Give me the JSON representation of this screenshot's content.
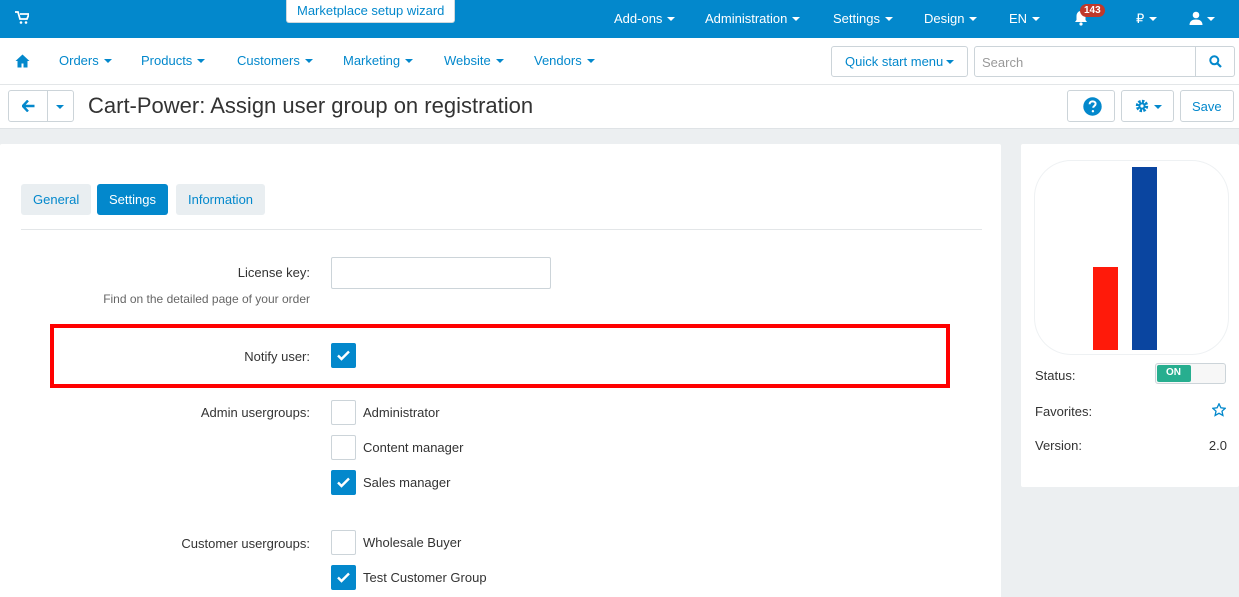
{
  "topbar": {
    "wizard_label": "Marketplace setup wizard",
    "menu": [
      "Add-ons",
      "Administration",
      "Settings",
      "Design",
      "EN",
      "₽"
    ],
    "notifications_count": "143",
    "icons": [
      "cart-icon",
      "bell-icon",
      "user-icon"
    ]
  },
  "subnav": {
    "items": [
      "Orders",
      "Products",
      "Customers",
      "Marketing",
      "Website",
      "Vendors"
    ],
    "quick_start": "Quick start menu",
    "search_placeholder": "Search"
  },
  "titlebar": {
    "title": "Cart-Power: Assign user group on registration",
    "save_label": "Save"
  },
  "tabs": [
    {
      "label": "General",
      "active": false
    },
    {
      "label": "Settings",
      "active": true
    },
    {
      "label": "Information",
      "active": false
    }
  ],
  "settings": {
    "license_key_label": "License key:",
    "license_key_value": "",
    "license_key_hint": "Find on the detailed page of your order",
    "notify_user_label": "Notify user:",
    "notify_user_checked": true,
    "admin_usergroups_label": "Admin usergroups:",
    "admin_usergroups": [
      {
        "label": "Administrator",
        "checked": false
      },
      {
        "label": "Content manager",
        "checked": false
      },
      {
        "label": "Sales manager",
        "checked": true
      }
    ],
    "customer_usergroups_label": "Customer usergroups:",
    "customer_usergroups": [
      {
        "label": "Wholesale Buyer",
        "checked": false
      },
      {
        "label": "Test Customer Group",
        "checked": true
      }
    ]
  },
  "sidebar": {
    "status_label": "Status:",
    "status_value": "ON",
    "favorites_label": "Favorites:",
    "version_label": "Version:",
    "version_value": "2.0"
  },
  "colors": {
    "accent": "#0388cc",
    "highlight": "#ff0000",
    "status_on": "#27ae8f",
    "logo_red": "#ff1a0a",
    "logo_blue": "#0a45a0"
  }
}
